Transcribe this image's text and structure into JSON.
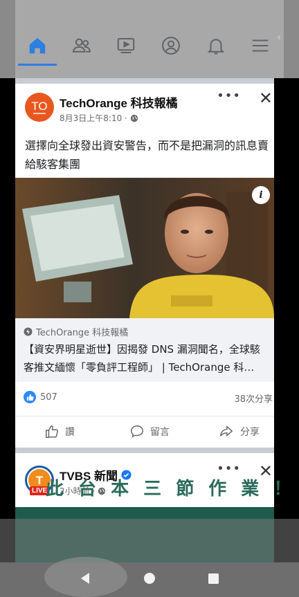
{
  "nav": {
    "items": [
      "home-icon",
      "friends-icon",
      "watch-icon",
      "profile-icon",
      "notifications-icon",
      "menu-icon"
    ],
    "active": "home-icon",
    "accent": "#2d7fe0"
  },
  "post1": {
    "page_name": "TechOrange 科技報橘",
    "avatar_text": "TO",
    "avatar_color": "#e8571e",
    "timestamp": "8月3日上午8:10 ·",
    "text": "選擇向全球發出資安警告，而不是把漏洞的訊息賣給駭客集團",
    "link_source": "TechOrange 科技報橘",
    "link_title": "【資安界明星逝世】因揭發 DNS 漏洞聞名，全球駭客推文緬懷「零負評工程師」 | TechOrange 科…",
    "reaction_count": "507",
    "shares": "38次分享",
    "actions": {
      "like": "讚",
      "comment": "留言",
      "share": "分享"
    }
  },
  "post2": {
    "page_name": "TVBS 新聞",
    "timestamp": "2小時前 ·",
    "live_badge": "LIVE",
    "teaser_text": "此 台 本 三 節 作 業 ！"
  }
}
